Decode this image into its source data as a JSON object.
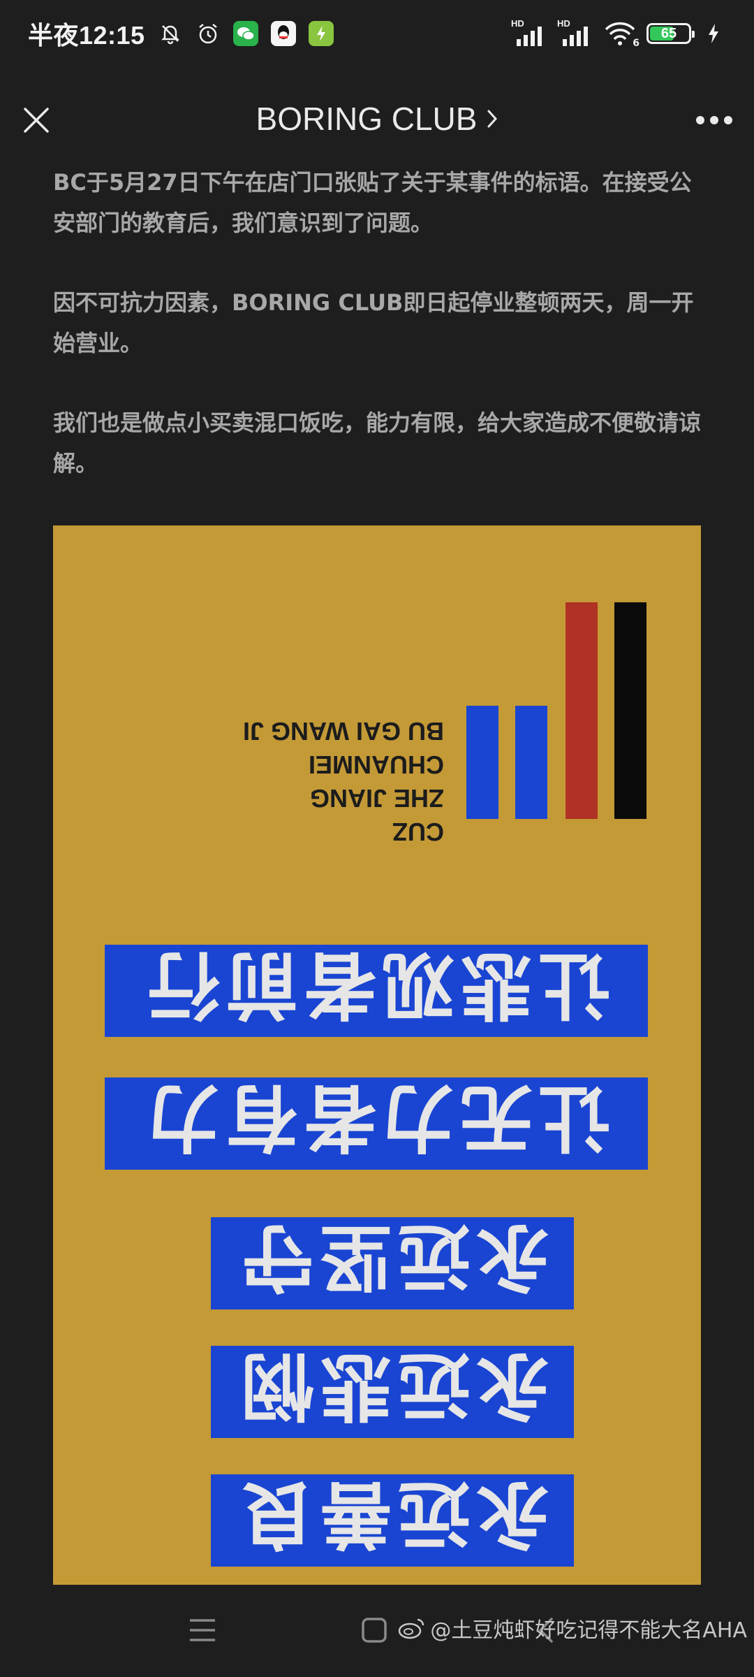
{
  "status_bar": {
    "time": "半夜12:15",
    "hd_label_1": "HD",
    "hd_label_2": "HD",
    "wifi_sub": "6",
    "battery": "65",
    "battery_level": 0.65
  },
  "nav": {
    "title": "BORING CLUB"
  },
  "article": {
    "paragraphs": [
      "BC于5月27日下午在店门口张贴了关于某事件的标语。在接受公安部门的教育后，我们意识到了问题。",
      "因不可抗力因素，BORING CLUB即日起停业整顿两天，周一开始营业。",
      "我们也是做点小买卖混口饭吃，能力有限，给大家造成不便敬请谅解。"
    ]
  },
  "poster": {
    "background": "#c49a37",
    "bar_colors": [
      "#1a45d2",
      "#1a45d2",
      "#b03224",
      "#0a0a0a"
    ],
    "credit_lines": [
      "CUZ",
      "ZHE JIANG CHUANMEI",
      "BU GAI WANG JI"
    ],
    "slogans": [
      "让悲观者前行",
      "让无力者有力",
      "永远坚守",
      "永远悲悯",
      "永远善良"
    ],
    "slogan_bg": "#1a45d2"
  },
  "watermark": {
    "text": "@土豆炖虾好吃记得不能大名AHA"
  },
  "icons": {
    "close": "close-icon",
    "more": "more-icon",
    "menu": "menu-icon",
    "home": "home-icon",
    "back": "back-icon",
    "weibo": "weibo-icon"
  }
}
